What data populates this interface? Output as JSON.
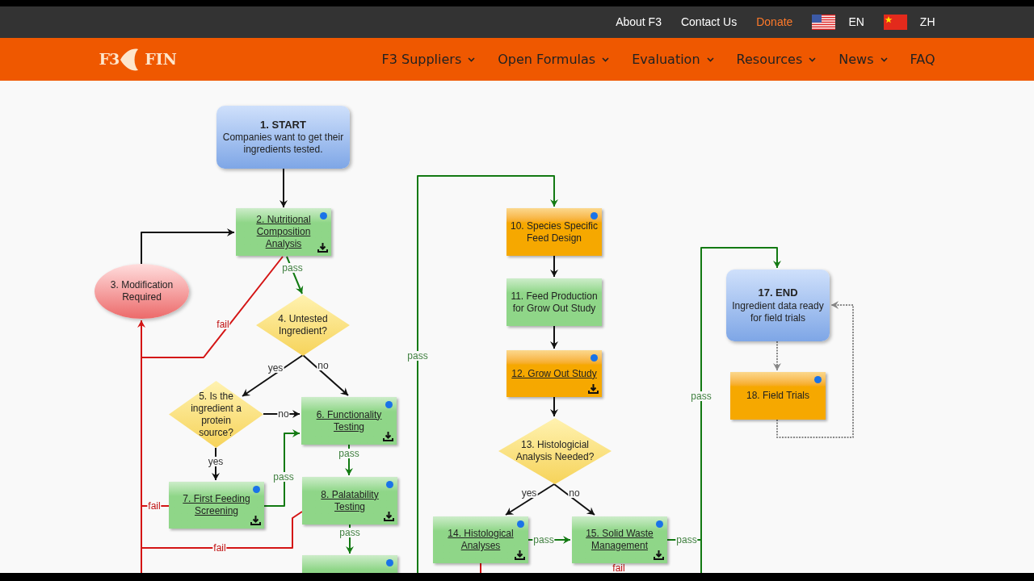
{
  "logo": {
    "mark": "F3",
    "text": "FIN"
  },
  "top_links": [
    {
      "label": "About F3",
      "highlight": false
    },
    {
      "label": "Contact Us",
      "highlight": false
    },
    {
      "label": "Donate",
      "highlight": true
    }
  ],
  "languages": [
    {
      "label": "EN",
      "kind": "us"
    },
    {
      "label": "ZH",
      "kind": "cn"
    }
  ],
  "nav": [
    {
      "label": "F3 Suppliers",
      "dropdown": true
    },
    {
      "label": "Open Formulas",
      "dropdown": true
    },
    {
      "label": "Evaluation",
      "dropdown": true
    },
    {
      "label": "Resources",
      "dropdown": true
    },
    {
      "label": "News",
      "dropdown": true
    },
    {
      "label": "FAQ",
      "dropdown": false
    }
  ],
  "flowchart": {
    "nodes": [
      {
        "kind": "terminal",
        "title": "1. START",
        "text": "Companies want to get their ingredients tested."
      },
      {
        "kind": "step",
        "color": "#8fd688",
        "label": "2. Nutritional Composition Analysis",
        "link": true,
        "dot": true,
        "download": true
      },
      {
        "kind": "ellipse",
        "label": "3. Modification Required"
      },
      {
        "kind": "decision",
        "label": "4. Untested Ingredient?"
      },
      {
        "kind": "decision",
        "label": "5. Is the ingredient a protein source?"
      },
      {
        "kind": "step",
        "color": "#8fd688",
        "label": "6. Functionality Testing",
        "link": true,
        "dot": true,
        "download": true
      },
      {
        "kind": "step",
        "color": "#8fd688",
        "label": "7. First Feeding Screening",
        "link": true,
        "dot": true,
        "download": true
      },
      {
        "kind": "step",
        "color": "#8fd688",
        "label": "8. Palatability Testing",
        "link": true,
        "dot": true,
        "download": true
      },
      {
        "kind": "step",
        "color": "#8fd688",
        "dot": true
      },
      {
        "kind": "step",
        "color": "#f6a800",
        "label": "10. Species Specific Feed Design",
        "link": false,
        "dot": true,
        "download": false
      },
      {
        "kind": "step",
        "color": "#8fd688",
        "label": "11. Feed Production for Grow Out Study",
        "link": false,
        "dot": false,
        "download": false
      },
      {
        "kind": "step",
        "color": "#f6a800",
        "label": "12. Grow Out Study",
        "link": true,
        "dot": true,
        "download": true
      },
      {
        "kind": "decision",
        "label": "13. Histologicial Analysis Needed?"
      },
      {
        "kind": "step",
        "color": "#8fd688",
        "label": "14. Histological Analyses",
        "link": true,
        "dot": true,
        "download": true
      },
      {
        "kind": "step",
        "color": "#8fd688",
        "label": "15. Solid Waste Management",
        "link": true,
        "dot": true,
        "download": true
      },
      {
        "kind": "terminal",
        "title": "17. END",
        "text": "Ingredient data ready for field trials"
      },
      {
        "kind": "step",
        "color": "#f6a800",
        "label": "18. Field Trials",
        "link": false,
        "dot": true,
        "download": false
      }
    ],
    "edges": [
      {
        "kind": "flow"
      },
      {
        "kind": "flow"
      },
      {
        "kind": "pass",
        "label": "pass"
      },
      {
        "kind": "fail",
        "label": "fail"
      },
      {
        "kind": "flow",
        "label": "yes"
      },
      {
        "kind": "flow",
        "label": "no"
      },
      {
        "kind": "flow",
        "label": "no"
      },
      {
        "kind": "flow",
        "label": "yes"
      },
      {
        "kind": "pass",
        "label": "pass"
      },
      {
        "kind": "pass",
        "label": "pass"
      },
      {
        "kind": "pass",
        "label": "pass"
      },
      {
        "kind": "fail",
        "label": "fail"
      },
      {
        "kind": "fail",
        "label": "fail"
      },
      {
        "kind": "fail"
      },
      {
        "kind": "pass",
        "label": "pass"
      },
      {
        "kind": "flow"
      },
      {
        "kind": "flow"
      },
      {
        "kind": "flow"
      },
      {
        "kind": "flow",
        "label": "yes"
      },
      {
        "kind": "flow",
        "label": "no"
      },
      {
        "kind": "pass",
        "label": "pass"
      },
      {
        "kind": "pass",
        "label": "pass"
      },
      {
        "kind": "pass",
        "label": "pass"
      },
      {
        "kind": "fail"
      },
      {
        "kind": "fail",
        "label": "fail"
      },
      {
        "kind": "optional"
      },
      {
        "kind": "optional"
      }
    ]
  }
}
